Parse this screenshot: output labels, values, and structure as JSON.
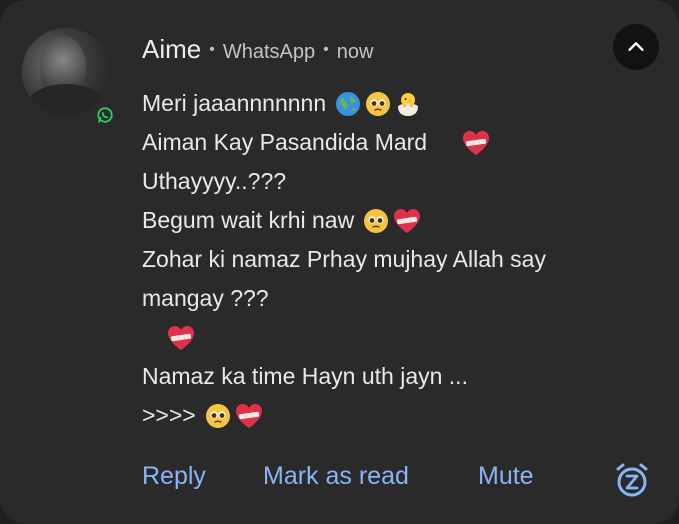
{
  "notification": {
    "sender": "Aime",
    "separator": "•",
    "app": "WhatsApp",
    "time": "now",
    "messages": [
      {
        "text": "Meri jaaannnnnnn",
        "emojis": [
          "globe-icon",
          "pleading-face-icon",
          "hatching-chick-icon"
        ]
      },
      {
        "text": "Aiman Kay Pasandida Mard",
        "emojis": [
          "mending-heart-icon"
        ]
      },
      {
        "text": "Uthayyyy..???",
        "emojis": []
      },
      {
        "text": "Begum wait krhi naw",
        "emojis": [
          "pleading-face-icon",
          "mending-heart-icon"
        ]
      },
      {
        "text": "Zohar ki namaz Prhay mujhay Allah say",
        "emojis": []
      },
      {
        "text": "mangay ???",
        "emojis": []
      },
      {
        "text": "",
        "emojis": [
          "mending-heart-icon"
        ]
      },
      {
        "text": "Namaz ka time Hayn uth jayn ...",
        "emojis": []
      },
      {
        "text": ">>>>",
        "emojis": [
          "pleading-face-icon",
          "mending-heart-icon"
        ]
      }
    ],
    "actions": {
      "reply": "Reply",
      "mark_as_read": "Mark as read",
      "mute": "Mute"
    }
  },
  "colors": {
    "background": "#2a2a2a",
    "text": "#e9e9e9",
    "action": "#8ab4f8",
    "whatsapp_green": "#25d366"
  }
}
